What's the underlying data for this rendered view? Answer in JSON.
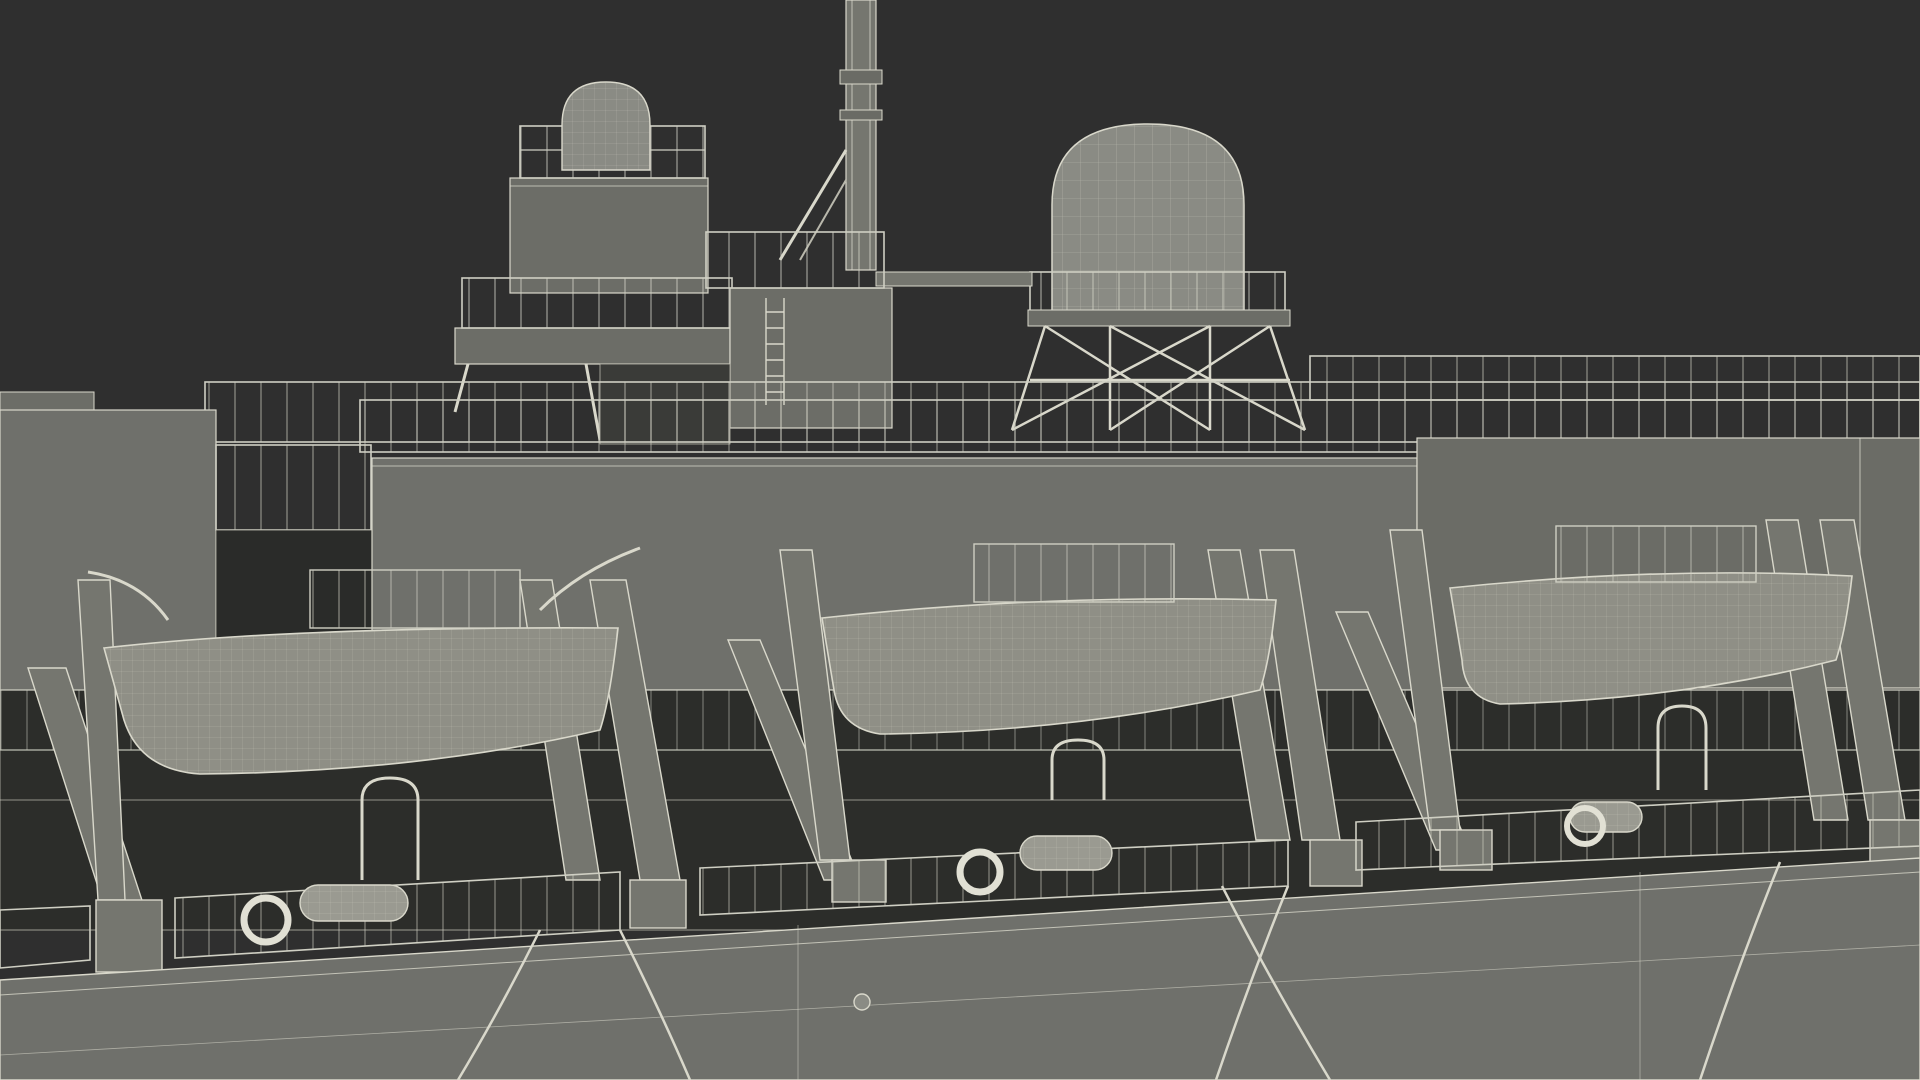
{
  "scene": {
    "subject": "ship-superstructure-wireframe-render",
    "colors": {
      "background": "#2f2f2f",
      "hull": "#6f706b",
      "hull_dark": "#585954",
      "structure": "#75766f",
      "structure_light": "#8a8b84",
      "structure_dark": "#55564f",
      "wire": "#d9d8cb",
      "wire_soft": "#b9b8ac",
      "shadow": "#242423",
      "boat_fill": "#8f8f86"
    },
    "lifeboat_count": 3,
    "liferaft_canister_count": 3,
    "lifebuoy_count": 3,
    "radome_count": 2
  }
}
